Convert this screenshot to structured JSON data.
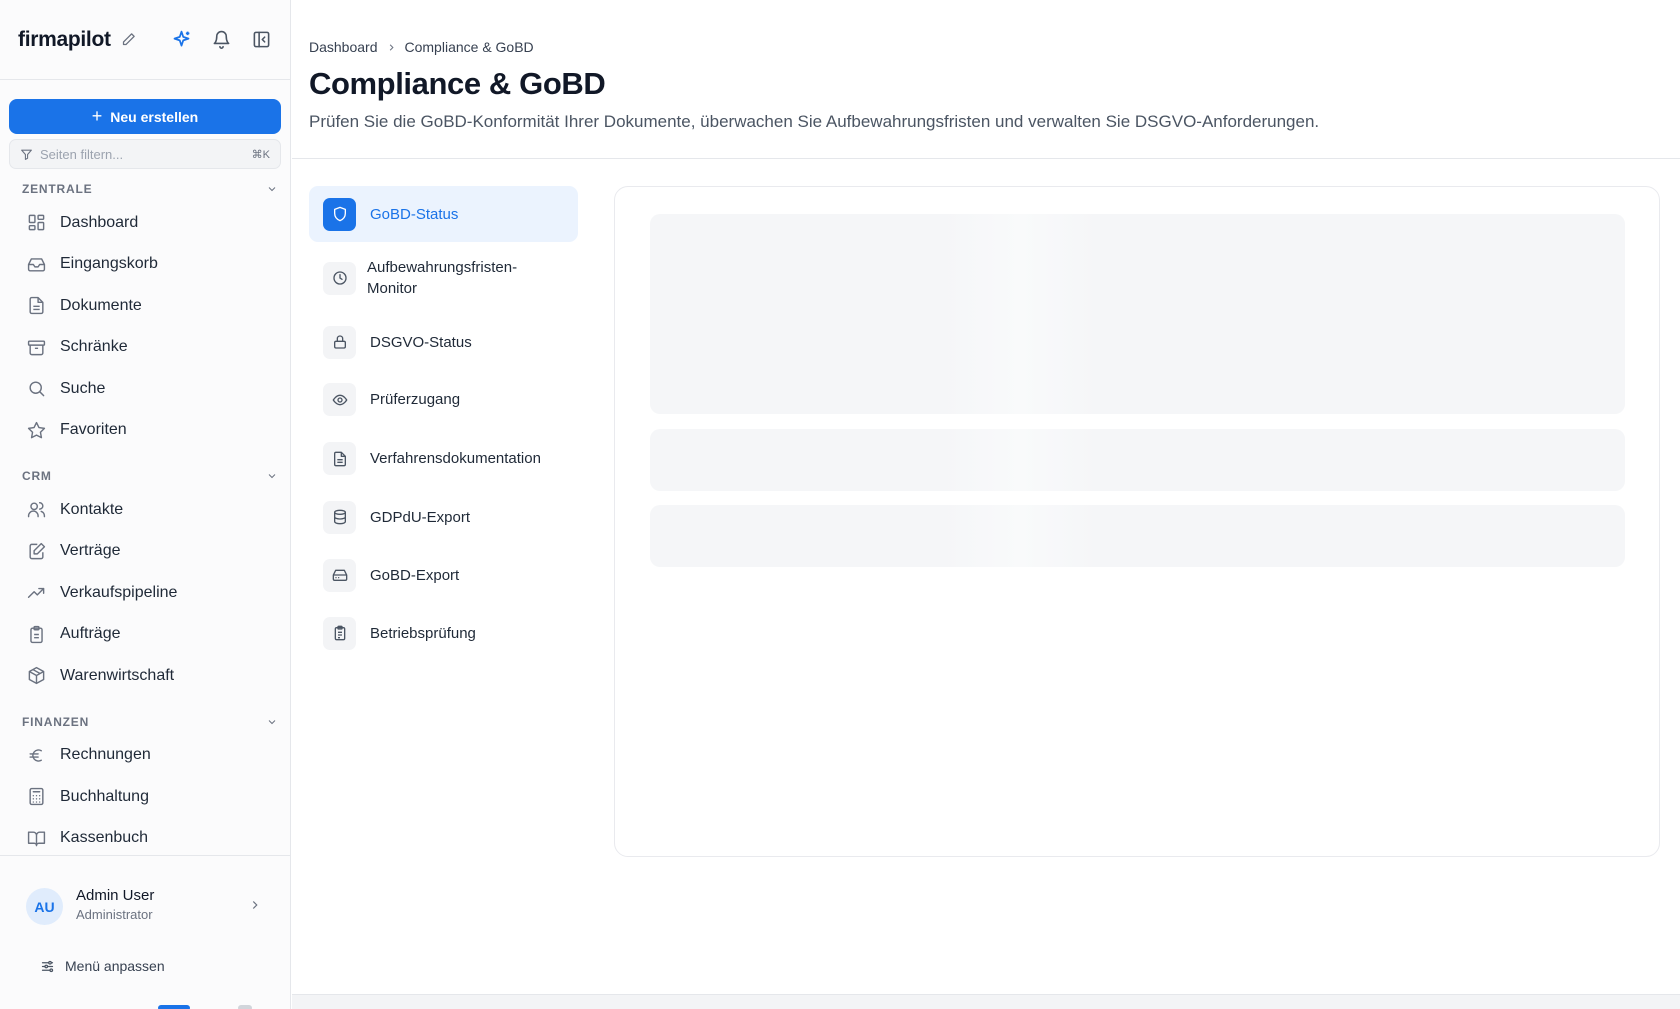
{
  "app": {
    "brand": "firmapilot"
  },
  "sidebar": {
    "new_button": "Neu erstellen",
    "filter_placeholder": "Seiten filtern...",
    "filter_shortcut": "⌘K",
    "sections": [
      {
        "title": "ZENTRALE",
        "items": [
          {
            "label": "Dashboard",
            "icon": "dashboard-icon"
          },
          {
            "label": "Eingangskorb",
            "icon": "inbox-icon"
          },
          {
            "label": "Dokumente",
            "icon": "document-icon"
          },
          {
            "label": "Schränke",
            "icon": "archive-icon"
          },
          {
            "label": "Suche",
            "icon": "search-icon"
          },
          {
            "label": "Favoriten",
            "icon": "star-icon"
          }
        ]
      },
      {
        "title": "CRM",
        "items": [
          {
            "label": "Kontakte",
            "icon": "users-icon"
          },
          {
            "label": "Verträge",
            "icon": "contract-icon"
          },
          {
            "label": "Verkaufspipeline",
            "icon": "trending-icon"
          },
          {
            "label": "Aufträge",
            "icon": "clipboard-icon"
          },
          {
            "label": "Warenwirtschaft",
            "icon": "package-icon"
          }
        ]
      },
      {
        "title": "FINANZEN",
        "items": [
          {
            "label": "Rechnungen",
            "icon": "euro-icon"
          },
          {
            "label": "Buchhaltung",
            "icon": "calculator-icon"
          },
          {
            "label": "Kassenbuch",
            "icon": "book-icon"
          }
        ]
      }
    ],
    "user": {
      "initials": "AU",
      "name": "Admin User",
      "role": "Administrator"
    },
    "menu_adjust": "Menü anpassen"
  },
  "main": {
    "breadcrumb": [
      "Dashboard",
      "Compliance & GoBD"
    ],
    "title": "Compliance & GoBD",
    "subtitle": "Prüfen Sie die GoBD-Konformität Ihrer Dokumente, überwachen Sie Aufbewahrungsfristen und verwalten Sie DSGVO-Anforderungen.",
    "tabs": [
      {
        "label": "GoBD-Status",
        "icon": "shield-icon",
        "active": true
      },
      {
        "label": "Aufbewahrungsfristen-Monitor",
        "icon": "clock-icon",
        "active": false
      },
      {
        "label": "DSGVO-Status",
        "icon": "lock-icon",
        "active": false
      },
      {
        "label": "Prüferzugang",
        "icon": "eye-icon",
        "active": false
      },
      {
        "label": "Verfahrensdokumentation",
        "icon": "file-text-icon",
        "active": false
      },
      {
        "label": "GDPdU-Export",
        "icon": "database-icon",
        "active": false
      },
      {
        "label": "GoBD-Export",
        "icon": "hard-drive-icon",
        "active": false
      },
      {
        "label": "Betriebsprüfung",
        "icon": "clipboard-check-icon",
        "active": false
      }
    ]
  },
  "colors": {
    "accent": "#1a73e8",
    "active_bg": "#ebf3fe",
    "skeleton": "#f5f6f8"
  }
}
